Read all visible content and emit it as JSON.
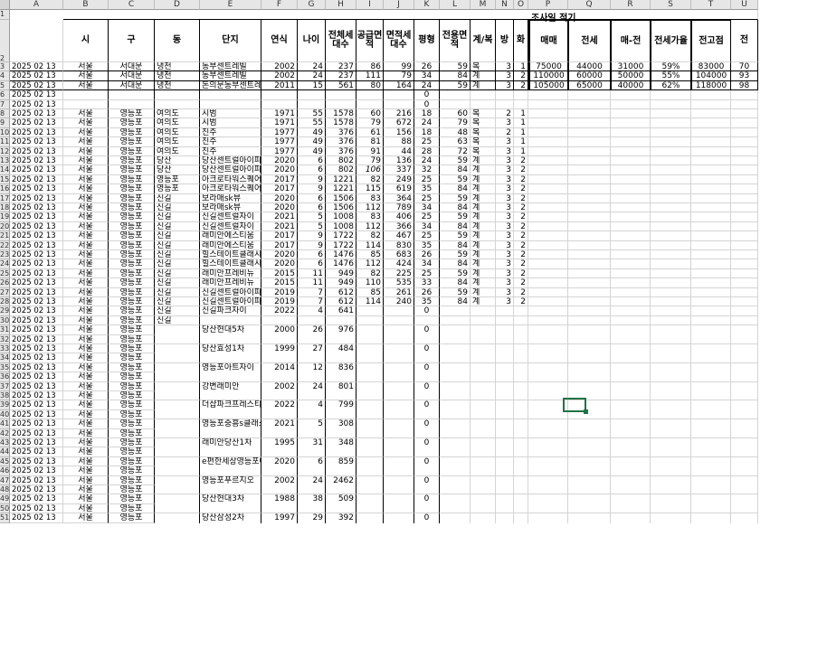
{
  "sheet_title": "조사일 적기",
  "columns": [
    "A",
    "B",
    "C",
    "D",
    "E",
    "F",
    "G",
    "H",
    "I",
    "J",
    "K",
    "L",
    "M",
    "N",
    "O",
    "P",
    "Q",
    "R",
    "S",
    "T",
    "U"
  ],
  "header": [
    "",
    "시",
    "구",
    "동",
    "단지",
    "연식",
    "나이",
    "전체세대수",
    "공급면적",
    "면적세대수",
    "평형",
    "전용면적",
    "계/복",
    "방",
    "화",
    "매매",
    "전세",
    "매-전",
    "전세가율",
    "전고점",
    "전"
  ],
  "rows": [
    {
      "n": "3",
      "a": "2025 02 13",
      "b": "서울",
      "c": "서대문",
      "d": "냉천",
      "e": "동부센트레빌",
      "f": "2002",
      "g": "24",
      "h": "237",
      "i": "86",
      "j": "99",
      "k": "26",
      "l": "59",
      "m": "복",
      "n2": "3",
      "o": "1",
      "p": "75000",
      "q": "44000",
      "r": "31000",
      "s": "59%",
      "t": "83000",
      "u": "70"
    },
    {
      "n": "4",
      "a": "2025 02 13",
      "b": "서울",
      "c": "서대문",
      "d": "냉천",
      "e": "동부센트레빌",
      "f": "2002",
      "g": "24",
      "h": "237",
      "i": "111",
      "j": "79",
      "k": "34",
      "l": "84",
      "m": "계",
      "n2": "3",
      "o": "2",
      "p": "110000",
      "q": "60000",
      "r": "50000",
      "s": "55%",
      "t": "104000",
      "u": "93"
    },
    {
      "n": "5",
      "a": "2025 02 13",
      "b": "서울",
      "c": "서대문",
      "d": "냉천",
      "e": "돈의문동부센트레빌",
      "f": "2011",
      "g": "15",
      "h": "561",
      "i": "80",
      "j": "164",
      "k": "24",
      "l": "59",
      "m": "계",
      "n2": "3",
      "o": "2",
      "p": "105000",
      "q": "65000",
      "r": "40000",
      "s": "62%",
      "t": "118000",
      "u": "98"
    },
    {
      "n": "6",
      "a": "2025 02 13",
      "k": "0"
    },
    {
      "n": "7",
      "a": "2025 02 13",
      "k": "0"
    },
    {
      "n": "8",
      "a": "2025 02 13",
      "b": "서울",
      "c": "영등포",
      "d": "여의도",
      "e": "시범",
      "f": "1971",
      "g": "55",
      "h": "1578",
      "i": "60",
      "j": "216",
      "k": "18",
      "l": "60",
      "m": "복",
      "n2": "2",
      "o": "1"
    },
    {
      "n": "9",
      "a": "2025 02 13",
      "b": "서울",
      "c": "영등포",
      "d": "여의도",
      "e": "시범",
      "f": "1971",
      "g": "55",
      "h": "1578",
      "i": "79",
      "j": "672",
      "k": "24",
      "l": "79",
      "m": "복",
      "n2": "3",
      "o": "1"
    },
    {
      "n": "10",
      "a": "2025 02 13",
      "b": "서울",
      "c": "영등포",
      "d": "여의도",
      "e": "진주",
      "f": "1977",
      "g": "49",
      "h": "376",
      "i": "61",
      "j": "156",
      "k": "18",
      "l": "48",
      "m": "복",
      "n2": "2",
      "o": "1"
    },
    {
      "n": "11",
      "a": "2025 02 13",
      "b": "서울",
      "c": "영등포",
      "d": "여의도",
      "e": "진주",
      "f": "1977",
      "g": "49",
      "h": "376",
      "i": "81",
      "j": "88",
      "k": "25",
      "l": "63",
      "m": "복",
      "n2": "3",
      "o": "1"
    },
    {
      "n": "12",
      "a": "2025 02 13",
      "b": "서울",
      "c": "영등포",
      "d": "여의도",
      "e": "진주",
      "f": "1977",
      "g": "49",
      "h": "376",
      "i": "91",
      "j": "44",
      "k": "28",
      "l": "72",
      "m": "복",
      "n2": "3",
      "o": "1"
    },
    {
      "n": "13",
      "a": "2025 02 13",
      "b": "서울",
      "c": "영등포",
      "d": "당산",
      "e": "당산센트럴아이파크",
      "f": "2020",
      "g": "6",
      "h": "802",
      "i": "79",
      "j": "136",
      "k": "24",
      "l": "59",
      "m": "계",
      "n2": "3",
      "o": "2"
    },
    {
      "n": "14",
      "a": "2025 02 13",
      "b": "서울",
      "c": "영등포",
      "d": "당산",
      "e": "당산센트럴아이파크",
      "f": "2020",
      "g": "6",
      "h": "802",
      "i": "106",
      "j": "337",
      "k": "32",
      "l": "84",
      "m": "계",
      "n2": "3",
      "o": "2",
      "it": true
    },
    {
      "n": "15",
      "a": "2025 02 13",
      "b": "서울",
      "c": "영등포",
      "d": "영등포",
      "e": "아크로타워스퀘어",
      "f": "2017",
      "g": "9",
      "h": "1221",
      "i": "82",
      "j": "249",
      "k": "25",
      "l": "59",
      "m": "계",
      "n2": "3",
      "o": "2"
    },
    {
      "n": "16",
      "a": "2025 02 13",
      "b": "서울",
      "c": "영등포",
      "d": "영등포",
      "e": "아크로타워스퀘어",
      "f": "2017",
      "g": "9",
      "h": "1221",
      "i": "115",
      "j": "619",
      "k": "35",
      "l": "84",
      "m": "계",
      "n2": "3",
      "o": "2"
    },
    {
      "n": "17",
      "a": "2025 02 13",
      "b": "서울",
      "c": "영등포",
      "d": "신길",
      "e": "보라매sk뷰",
      "f": "2020",
      "g": "6",
      "h": "1506",
      "i": "83",
      "j": "364",
      "k": "25",
      "l": "59",
      "m": "계",
      "n2": "3",
      "o": "2"
    },
    {
      "n": "18",
      "a": "2025 02 13",
      "b": "서울",
      "c": "영등포",
      "d": "신길",
      "e": "보라매sk뷰",
      "f": "2020",
      "g": "6",
      "h": "1506",
      "i": "112",
      "j": "789",
      "k": "34",
      "l": "84",
      "m": "계",
      "n2": "3",
      "o": "2"
    },
    {
      "n": "19",
      "a": "2025 02 13",
      "b": "서울",
      "c": "영등포",
      "d": "신길",
      "e": "신길센트럴자이",
      "f": "2021",
      "g": "5",
      "h": "1008",
      "i": "83",
      "j": "406",
      "k": "25",
      "l": "59",
      "m": "계",
      "n2": "3",
      "o": "2"
    },
    {
      "n": "20",
      "a": "2025 02 13",
      "b": "서울",
      "c": "영등포",
      "d": "신길",
      "e": "신길센트럴자이",
      "f": "2021",
      "g": "5",
      "h": "1008",
      "i": "112",
      "j": "366",
      "k": "34",
      "l": "84",
      "m": "계",
      "n2": "3",
      "o": "2"
    },
    {
      "n": "21",
      "a": "2025 02 13",
      "b": "서울",
      "c": "영등포",
      "d": "신길",
      "e": "래미안에스티움",
      "f": "2017",
      "g": "9",
      "h": "1722",
      "i": "82",
      "j": "467",
      "k": "25",
      "l": "59",
      "m": "계",
      "n2": "3",
      "o": "2"
    },
    {
      "n": "22",
      "a": "2025 02 13",
      "b": "서울",
      "c": "영등포",
      "d": "신길",
      "e": "래미안에스티움",
      "f": "2017",
      "g": "9",
      "h": "1722",
      "i": "114",
      "j": "830",
      "k": "35",
      "l": "84",
      "m": "계",
      "n2": "3",
      "o": "2"
    },
    {
      "n": "23",
      "a": "2025 02 13",
      "b": "서울",
      "c": "영등포",
      "d": "신길",
      "e": "힐스테이트클래시안",
      "f": "2020",
      "g": "6",
      "h": "1476",
      "i": "85",
      "j": "683",
      "k": "26",
      "l": "59",
      "m": "계",
      "n2": "3",
      "o": "2"
    },
    {
      "n": "24",
      "a": "2025 02 13",
      "b": "서울",
      "c": "영등포",
      "d": "신길",
      "e": "힐스테이트클래시안",
      "f": "2020",
      "g": "6",
      "h": "1476",
      "i": "112",
      "j": "424",
      "k": "34",
      "l": "84",
      "m": "계",
      "n2": "3",
      "o": "2"
    },
    {
      "n": "25",
      "a": "2025 02 13",
      "b": "서울",
      "c": "영등포",
      "d": "신길",
      "e": "래미안프레비뉴",
      "f": "2015",
      "g": "11",
      "h": "949",
      "i": "82",
      "j": "225",
      "k": "25",
      "l": "59",
      "m": "계",
      "n2": "3",
      "o": "2"
    },
    {
      "n": "26",
      "a": "2025 02 13",
      "b": "서울",
      "c": "영등포",
      "d": "신길",
      "e": "래미안프레비뉴",
      "f": "2015",
      "g": "11",
      "h": "949",
      "i": "110",
      "j": "535",
      "k": "33",
      "l": "84",
      "m": "계",
      "n2": "3",
      "o": "2"
    },
    {
      "n": "27",
      "a": "2025 02 13",
      "b": "서울",
      "c": "영등포",
      "d": "신길",
      "e": "신길센트럴아이파크",
      "f": "2019",
      "g": "7",
      "h": "612",
      "i": "85",
      "j": "261",
      "k": "26",
      "l": "59",
      "m": "계",
      "n2": "3",
      "o": "2"
    },
    {
      "n": "28",
      "a": "2025 02 13",
      "b": "서울",
      "c": "영등포",
      "d": "신길",
      "e": "신길센트럴아이파크",
      "f": "2019",
      "g": "7",
      "h": "612",
      "i": "114",
      "j": "240",
      "k": "35",
      "l": "84",
      "m": "계",
      "n2": "3",
      "o": "2"
    },
    {
      "n": "29",
      "a": "2025 02 13",
      "b": "서울",
      "c": "영등포",
      "d": "신길",
      "e": "신길파크자이",
      "f": "2022",
      "g": "4",
      "h": "641",
      "k": "0"
    },
    {
      "n": "30",
      "a": "2025 02 13",
      "b": "서울",
      "c": "영등포",
      "d": "신길"
    },
    {
      "n": "31",
      "a": "2025 02 13",
      "b": "서울",
      "c": "영등포",
      "e": "당산현대5차",
      "f": "2000",
      "g": "26",
      "h": "976",
      "k": "0",
      "merged": true
    },
    {
      "n": "32",
      "a": "2025 02 13",
      "b": "서울",
      "c": "영등포"
    },
    {
      "n": "33",
      "a": "2025 02 13",
      "b": "서울",
      "c": "영등포",
      "e": "당산효성1차",
      "f": "1999",
      "g": "27",
      "h": "484",
      "k": "0",
      "merged": true
    },
    {
      "n": "34",
      "a": "2025 02 13",
      "b": "서울",
      "c": "영등포"
    },
    {
      "n": "35",
      "a": "2025 02 13",
      "b": "서울",
      "c": "영등포",
      "e": "영등포아트자이",
      "f": "2014",
      "g": "12",
      "h": "836",
      "k": "0",
      "merged": true
    },
    {
      "n": "36",
      "a": "2025 02 13",
      "b": "서울",
      "c": "영등포"
    },
    {
      "n": "37",
      "a": "2025 02 13",
      "b": "서울",
      "c": "영등포",
      "e": "강변래미안",
      "f": "2002",
      "g": "24",
      "h": "801",
      "k": "0",
      "merged": true
    },
    {
      "n": "38",
      "a": "2025 02 13",
      "b": "서울",
      "c": "영등포"
    },
    {
      "n": "39",
      "a": "2025 02 13",
      "b": "서울",
      "c": "영등포",
      "e": "더샵파크프레스티지",
      "f": "2022",
      "g": "4",
      "h": "799",
      "k": "0",
      "merged": true
    },
    {
      "n": "40",
      "a": "2025 02 13",
      "b": "서울",
      "c": "영등포"
    },
    {
      "n": "41",
      "a": "2025 02 13",
      "b": "서울",
      "c": "영등포",
      "e": "영등포중흥s클래스",
      "f": "2021",
      "g": "5",
      "h": "308",
      "k": "0",
      "merged": true
    },
    {
      "n": "42",
      "a": "2025 02 13",
      "b": "서울",
      "c": "영등포"
    },
    {
      "n": "43",
      "a": "2025 02 13",
      "b": "서울",
      "c": "영등포",
      "e": "래미안당산1차",
      "f": "1995",
      "g": "31",
      "h": "348",
      "k": "0",
      "merged": true
    },
    {
      "n": "44",
      "a": "2025 02 13",
      "b": "서울",
      "c": "영등포"
    },
    {
      "n": "45",
      "a": "2025 02 13",
      "b": "서울",
      "c": "영등포",
      "e": "e편한세상영등포아",
      "f": "2020",
      "g": "6",
      "h": "859",
      "k": "0",
      "merged": true
    },
    {
      "n": "46",
      "a": "2025 02 13",
      "b": "서울",
      "c": "영등포"
    },
    {
      "n": "47",
      "a": "2025 02 13",
      "b": "서울",
      "c": "영등포",
      "e": "영등포푸르지오",
      "f": "2002",
      "g": "24",
      "h": "2462",
      "k": "0",
      "merged": true
    },
    {
      "n": "48",
      "a": "2025 02 13",
      "b": "서울",
      "c": "영등포"
    },
    {
      "n": "49",
      "a": "2025 02 13",
      "b": "서울",
      "c": "영등포",
      "e": "당산현대3차",
      "f": "1988",
      "g": "38",
      "h": "509",
      "k": "0",
      "merged": true
    },
    {
      "n": "50",
      "a": "2025 02 13",
      "b": "서울",
      "c": "영등포"
    },
    {
      "n": "51",
      "a": "2025 02 13",
      "b": "서울",
      "c": "영등포",
      "e": "당산삼성2차",
      "f": "1997",
      "g": "29",
      "h": "392",
      "k": "0",
      "merged": true
    }
  ]
}
